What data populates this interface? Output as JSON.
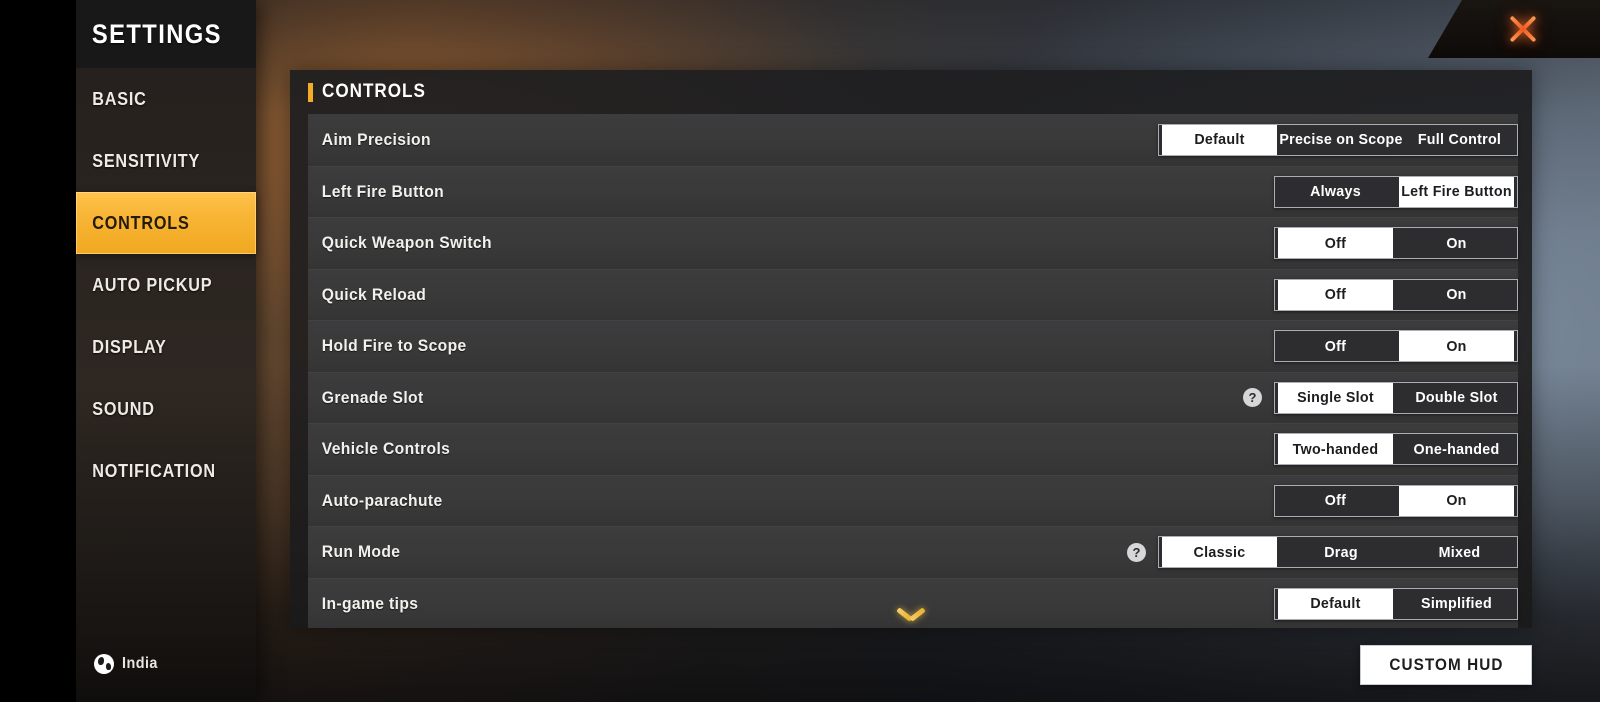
{
  "window": {
    "close_icon": "close-icon"
  },
  "sidebar": {
    "title": "SETTINGS",
    "items": [
      {
        "label": "BASIC",
        "active": false
      },
      {
        "label": "SENSITIVITY",
        "active": false
      },
      {
        "label": "CONTROLS",
        "active": true
      },
      {
        "label": "AUTO PICKUP",
        "active": false
      },
      {
        "label": "DISPLAY",
        "active": false
      },
      {
        "label": "SOUND",
        "active": false
      },
      {
        "label": "NOTIFICATION",
        "active": false
      }
    ],
    "locale": {
      "icon": "globe-icon",
      "label": "India"
    }
  },
  "content": {
    "header_title": "CONTROLS",
    "scroll_indicator_icon": "chevron-down-icon",
    "rows": [
      {
        "label": "Aim Precision",
        "help": false,
        "options": [
          "Default",
          "Precise on Scope",
          "Full Control"
        ],
        "selected": "Default",
        "widths": [
          121,
          122,
          115
        ]
      },
      {
        "label": "Left Fire Button",
        "help": false,
        "options": [
          "Always",
          "Left Fire Button"
        ],
        "selected": "Left Fire Button",
        "widths": [
          121,
          121
        ]
      },
      {
        "label": "Quick Weapon Switch",
        "help": false,
        "options": [
          "Off",
          "On"
        ],
        "selected": "Off",
        "widths": [
          121,
          121
        ]
      },
      {
        "label": "Quick Reload",
        "help": false,
        "options": [
          "Off",
          "On"
        ],
        "selected": "Off",
        "widths": [
          121,
          121
        ]
      },
      {
        "label": "Hold Fire to Scope",
        "help": false,
        "options": [
          "Off",
          "On"
        ],
        "selected": "On",
        "widths": [
          121,
          121
        ]
      },
      {
        "label": "Grenade Slot",
        "help": true,
        "options": [
          "Single Slot",
          "Double Slot"
        ],
        "selected": "Single Slot",
        "widths": [
          121,
          121
        ]
      },
      {
        "label": "Vehicle Controls",
        "help": false,
        "options": [
          "Two-handed",
          "One-handed"
        ],
        "selected": "Two-handed",
        "widths": [
          121,
          121
        ]
      },
      {
        "label": "Auto-parachute",
        "help": false,
        "options": [
          "Off",
          "On"
        ],
        "selected": "On",
        "widths": [
          121,
          121
        ]
      },
      {
        "label": "Run Mode",
        "help": true,
        "options": [
          "Classic",
          "Drag",
          "Mixed"
        ],
        "selected": "Classic",
        "widths": [
          121,
          122,
          115
        ]
      },
      {
        "label": "In-game tips",
        "help": false,
        "options": [
          "Default",
          "Simplified"
        ],
        "selected": "Default",
        "widths": [
          121,
          121
        ]
      }
    ]
  },
  "footer": {
    "custom_hud_label": "CUSTOM HUD"
  },
  "colors": {
    "accent": "#f4ab25",
    "active_nav": "#f7b333",
    "close": "#ef5a24",
    "selected_segment_bg": "#ffffff",
    "row_bg": "#3a3a3c"
  },
  "help_icon_glyph": "?"
}
